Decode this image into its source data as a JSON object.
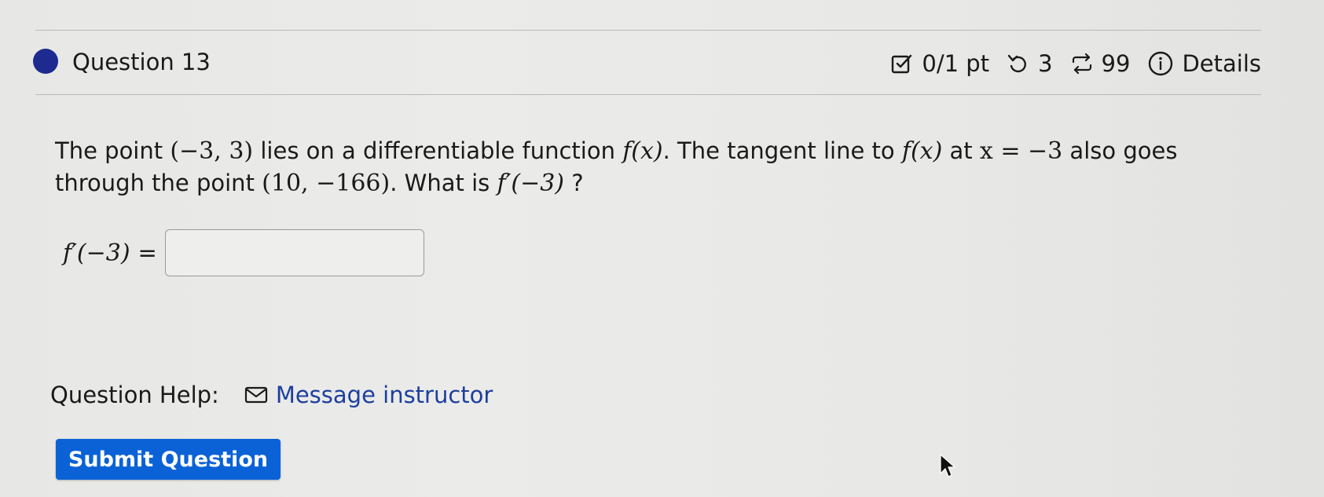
{
  "question": {
    "title": "Question 13",
    "score": "0/1 pt",
    "retries": "3",
    "attempts": "99",
    "details_label": "Details"
  },
  "problem": {
    "text_1": "The point ",
    "point_a": "(−3, 3)",
    "text_2": " lies on a differentiable function ",
    "func_1": "f(x)",
    "text_3": ". The tangent line to ",
    "func_2": "f(x)",
    "text_4": " at ",
    "cond": "x = −3",
    "text_5": " also goes",
    "text_6": "through the point ",
    "point_b": "(10, −166)",
    "text_7": ". What is ",
    "deriv": "f′(−3)",
    "text_8": " ?"
  },
  "answer": {
    "label": "f′(−3)",
    "equals": "=",
    "value": ""
  },
  "help": {
    "label": "Question Help:",
    "message_link": "Message instructor"
  },
  "submit_label": "Submit Question",
  "icons": {
    "score": "checkbox-edit-icon",
    "retries": "undo-icon",
    "attempts": "repeat-icon",
    "details": "info-circle-icon",
    "message": "envelope-icon",
    "cursor": "mouse-pointer-icon"
  },
  "colors": {
    "accent_dot": "#1d2a8f",
    "submit_bg": "#0b62d6",
    "link": "#1c3f9e"
  }
}
